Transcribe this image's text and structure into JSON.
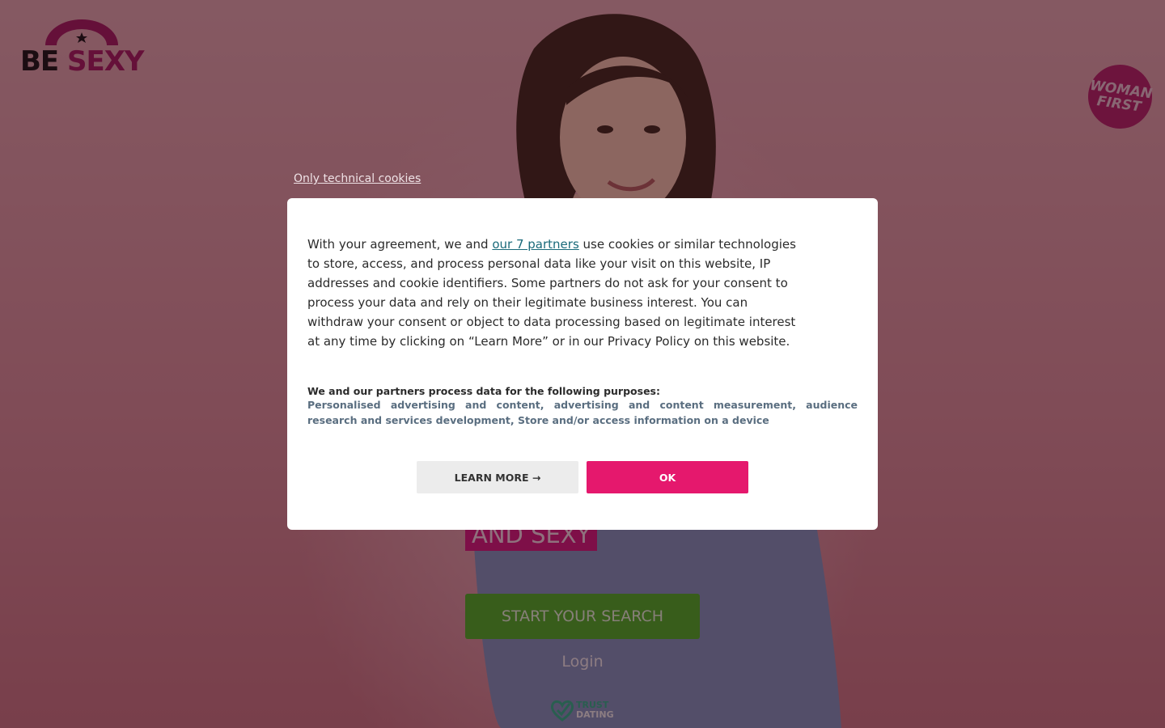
{
  "brand": {
    "logo_be": "BE",
    "logo_sexy": "SEXY",
    "badge_line1": "WOMAN",
    "badge_line2": "FIRST"
  },
  "hero": {
    "headline_fragment": "AND SEXY",
    "cta_label": "START YOUR SEARCH",
    "login_label": "Login",
    "trust_line1": "TRUST",
    "trust_line2": "DATING"
  },
  "cookie": {
    "technical_link": "Only technical cookies",
    "text_before_link": "With your agreement, we and ",
    "partners_link": "our 7 partners",
    "text_after_link": " use cookies or similar technologies to store, access, and process personal data like your visit on this website, IP addresses and cookie identifiers. Some partners do not ask for your consent to process your data and rely on their legitimate business interest. You can withdraw your consent or object to data processing based on legitimate interest at any time by clicking on “Learn More” or in our Privacy Policy on this website.",
    "purposes_heading": "We and our partners process data for the following purposes:",
    "purposes_list": "Personalised advertising and content, advertising and content measurement, audience research and services development, Store and/or access information on a device",
    "learn_more_label": "LEARN MORE →",
    "ok_label": "OK"
  },
  "colors": {
    "accent_pink": "#e5186d",
    "brand_magenta": "#a3175e",
    "cta_green": "#49b022",
    "link_teal": "#1a6a7a"
  }
}
